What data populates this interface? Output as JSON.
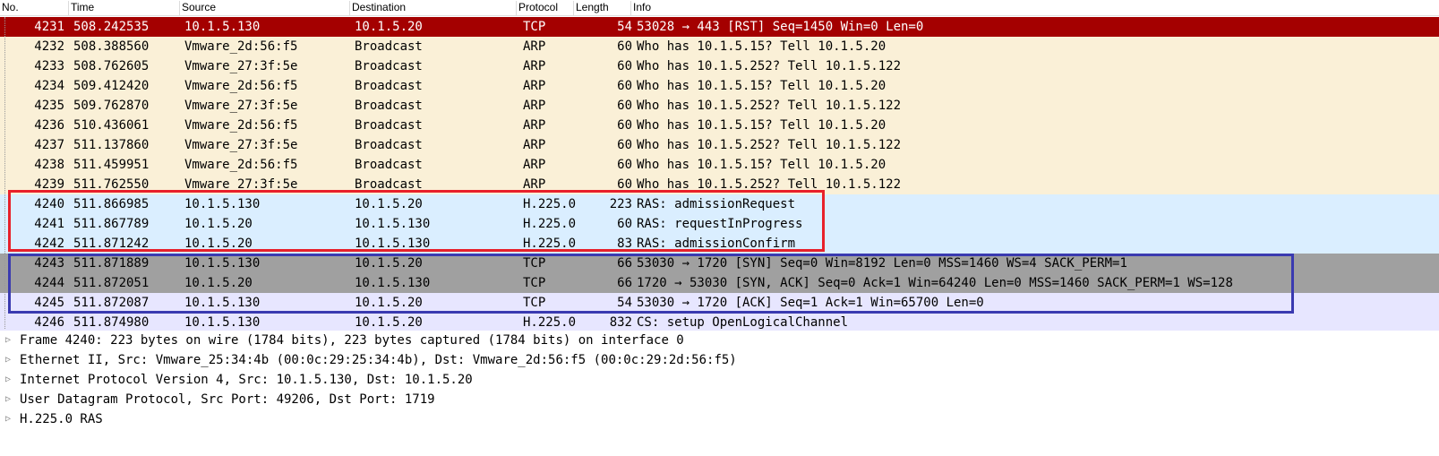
{
  "columns": {
    "no": "No.",
    "time": "Time",
    "source": "Source",
    "destination": "Destination",
    "protocol": "Protocol",
    "length": "Length",
    "info": "Info"
  },
  "colors": {
    "selected_bg": "#a40000",
    "selected_fg": "#ffffff",
    "arp_bg": "#faf0d7",
    "udp_bg": "#daeeff",
    "tcp_syn_bg": "#a0a0a0",
    "tcp_bg": "#e7e6ff",
    "red_box": "#e8202a",
    "blue_box": "#3a3ab0"
  },
  "packets": [
    {
      "no": "4231",
      "time": "508.242535",
      "source": "10.1.5.130",
      "destination": "10.1.5.20",
      "protocol": "TCP",
      "length": "54",
      "info": "53028 → 443 [RST] Seq=1450 Win=0 Len=0",
      "style": "selected"
    },
    {
      "no": "4232",
      "time": "508.388560",
      "source": "Vmware_2d:56:f5",
      "destination": "Broadcast",
      "protocol": "ARP",
      "length": "60",
      "info": "Who has 10.1.5.15? Tell 10.1.5.20",
      "style": "arp"
    },
    {
      "no": "4233",
      "time": "508.762605",
      "source": "Vmware_27:3f:5e",
      "destination": "Broadcast",
      "protocol": "ARP",
      "length": "60",
      "info": "Who has 10.1.5.252? Tell 10.1.5.122",
      "style": "arp"
    },
    {
      "no": "4234",
      "time": "509.412420",
      "source": "Vmware_2d:56:f5",
      "destination": "Broadcast",
      "protocol": "ARP",
      "length": "60",
      "info": "Who has 10.1.5.15? Tell 10.1.5.20",
      "style": "arp"
    },
    {
      "no": "4235",
      "time": "509.762870",
      "source": "Vmware_27:3f:5e",
      "destination": "Broadcast",
      "protocol": "ARP",
      "length": "60",
      "info": "Who has 10.1.5.252? Tell 10.1.5.122",
      "style": "arp"
    },
    {
      "no": "4236",
      "time": "510.436061",
      "source": "Vmware_2d:56:f5",
      "destination": "Broadcast",
      "protocol": "ARP",
      "length": "60",
      "info": "Who has 10.1.5.15? Tell 10.1.5.20",
      "style": "arp"
    },
    {
      "no": "4237",
      "time": "511.137860",
      "source": "Vmware_27:3f:5e",
      "destination": "Broadcast",
      "protocol": "ARP",
      "length": "60",
      "info": "Who has 10.1.5.252? Tell 10.1.5.122",
      "style": "arp"
    },
    {
      "no": "4238",
      "time": "511.459951",
      "source": "Vmware_2d:56:f5",
      "destination": "Broadcast",
      "protocol": "ARP",
      "length": "60",
      "info": "Who has 10.1.5.15? Tell 10.1.5.20",
      "style": "arp"
    },
    {
      "no": "4239",
      "time": "511.762550",
      "source": "Vmware_27:3f:5e",
      "destination": "Broadcast",
      "protocol": "ARP",
      "length": "60",
      "info": "Who has 10.1.5.252? Tell 10.1.5.122",
      "style": "arp"
    },
    {
      "no": "4240",
      "time": "511.866985",
      "source": "10.1.5.130",
      "destination": "10.1.5.20",
      "protocol": "H.225.0",
      "length": "223",
      "info": "RAS: admissionRequest",
      "style": "udp"
    },
    {
      "no": "4241",
      "time": "511.867789",
      "source": "10.1.5.20",
      "destination": "10.1.5.130",
      "protocol": "H.225.0",
      "length": "60",
      "info": "RAS: requestInProgress",
      "style": "udp"
    },
    {
      "no": "4242",
      "time": "511.871242",
      "source": "10.1.5.20",
      "destination": "10.1.5.130",
      "protocol": "H.225.0",
      "length": "83",
      "info": "RAS: admissionConfirm",
      "style": "udp"
    },
    {
      "no": "4243",
      "time": "511.871889",
      "source": "10.1.5.130",
      "destination": "10.1.5.20",
      "protocol": "TCP",
      "length": "66",
      "info": "53030 → 1720 [SYN] Seq=0 Win=8192 Len=0 MSS=1460 WS=4 SACK_PERM=1",
      "style": "syn"
    },
    {
      "no": "4244",
      "time": "511.872051",
      "source": "10.1.5.20",
      "destination": "10.1.5.130",
      "protocol": "TCP",
      "length": "66",
      "info": "1720 → 53030 [SYN, ACK] Seq=0 Ack=1 Win=64240 Len=0 MSS=1460 SACK_PERM=1 WS=128",
      "style": "syn"
    },
    {
      "no": "4245",
      "time": "511.872087",
      "source": "10.1.5.130",
      "destination": "10.1.5.20",
      "protocol": "TCP",
      "length": "54",
      "info": "53030 → 1720 [ACK] Seq=1 Ack=1 Win=65700 Len=0",
      "style": "tcp"
    },
    {
      "no": "4246",
      "time": "511.874980",
      "source": "10.1.5.130",
      "destination": "10.1.5.20",
      "protocol": "H.225.0",
      "length": "832",
      "info": "CS: setup OpenLogicalChannel",
      "style": "tcp"
    }
  ],
  "details": [
    {
      "text": "Frame 4240: 223 bytes on wire (1784 bits), 223 bytes captured (1784 bits) on interface 0",
      "icon": "expand-triangle-icon"
    },
    {
      "text": "Ethernet II, Src: Vmware_25:34:4b (00:0c:29:25:34:4b), Dst: Vmware_2d:56:f5 (00:0c:29:2d:56:f5)",
      "icon": "expand-triangle-icon"
    },
    {
      "text": "Internet Protocol Version 4, Src: 10.1.5.130, Dst: 10.1.5.20",
      "icon": "expand-triangle-icon"
    },
    {
      "text": "User Datagram Protocol, Src Port: 49206, Dst Port: 1719",
      "icon": "expand-triangle-icon"
    },
    {
      "text": "H.225.0 RAS",
      "icon": "expand-triangle-icon"
    }
  ]
}
